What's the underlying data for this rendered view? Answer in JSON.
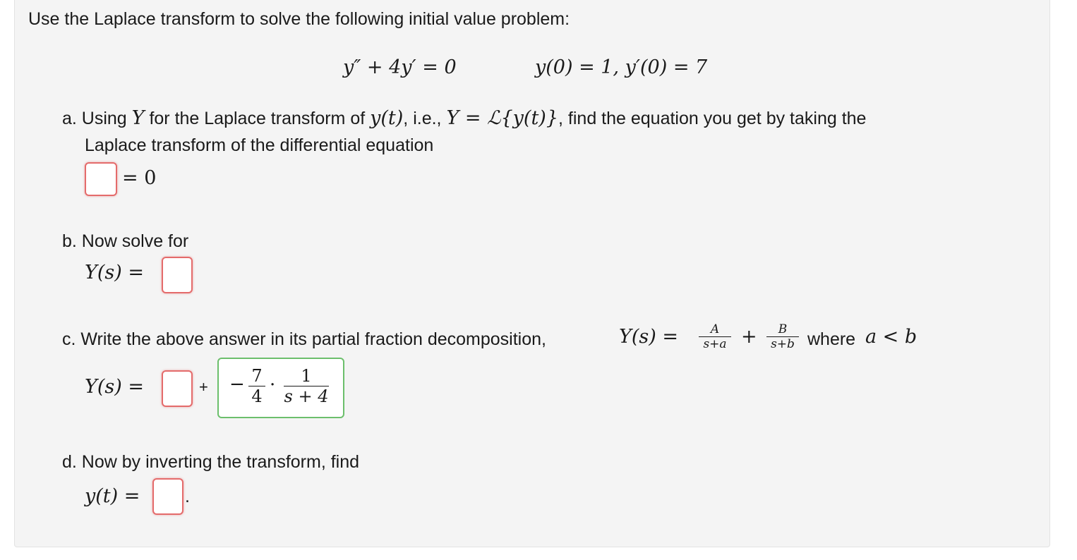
{
  "intro": "Use the Laplace transform to solve the following initial value problem:",
  "equation": {
    "ode": "y″ + 4y′ = 0",
    "initial_conditions": "y(0) = 1, y′(0) = 7"
  },
  "part_a": {
    "line1_prefix": "a. Using",
    "Y": "Y",
    "line1_mid": "for the Laplace transform of",
    "yt": "y(t)",
    "line1_ie": ", i.e.,",
    "def": "Y = ℒ{y(t)}",
    "line1_suffix": ", find the equation you get by taking the",
    "line2": "Laplace transform of the differential equation",
    "rhs": "= 0"
  },
  "part_b": {
    "label": "b. Now solve for",
    "lhs": "Y(s) ="
  },
  "part_c": {
    "label": "c. Write the above answer in its partial fraction decomposition,",
    "lhs_inline": "Y(s) =",
    "fracA_num": "A",
    "fracA_den": "s+a",
    "plus": "+",
    "fracB_num": "B",
    "fracB_den": "s+b",
    "where": "where",
    "cond": "a < b",
    "lhs": "Y(s) =",
    "plus_sign": "+",
    "answer": {
      "minus": "−",
      "coef_num": "7",
      "coef_den": "4",
      "dot": "·",
      "term_num": "1",
      "term_den": "s + 4"
    }
  },
  "part_d": {
    "label": "d. Now by inverting the transform, find",
    "lhs": "y(t) =",
    "period": "."
  }
}
